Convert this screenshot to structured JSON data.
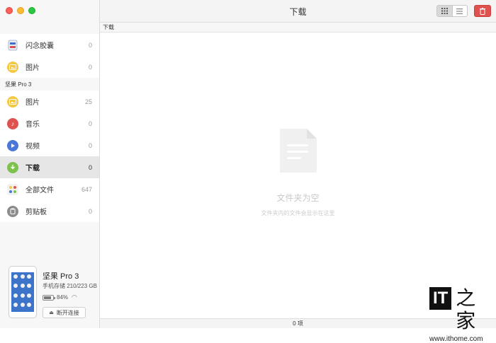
{
  "window": {
    "title": "下载"
  },
  "sidebar": {
    "top_items": [
      {
        "label": "闪念胶囊",
        "count": "0",
        "icon": "capsule-icon"
      },
      {
        "label": "图片",
        "count": "0",
        "icon": "image-icon"
      }
    ],
    "device_section_title": "坚果 Pro 3",
    "device_items": [
      {
        "label": "图片",
        "count": "25",
        "icon": "image-icon"
      },
      {
        "label": "音乐",
        "count": "0",
        "icon": "music-icon"
      },
      {
        "label": "视频",
        "count": "0",
        "icon": "video-icon"
      },
      {
        "label": "下载",
        "count": "0",
        "icon": "download-icon",
        "selected": true
      },
      {
        "label": "全部文件",
        "count": "647",
        "icon": "all-files-icon"
      },
      {
        "label": "剪贴板",
        "count": "0",
        "icon": "clipboard-icon"
      }
    ]
  },
  "device": {
    "name": "坚果 Pro 3",
    "storage": "手机存储 210/223 GB",
    "battery": "84%",
    "battery_level": 0.84,
    "disconnect_label": "断开连接"
  },
  "toolbar": {
    "grid_icon": "grid-view-icon",
    "list_icon": "list-view-icon",
    "delete_icon": "trash-icon",
    "delete_color": "#e0524f"
  },
  "pathbar": {
    "label": "下载"
  },
  "empty_state": {
    "title": "文件夹为空",
    "subtitle": "文件夹内的文件会显示在这里"
  },
  "status": {
    "count": "0 项"
  },
  "watermark": {
    "logo_text": "IT",
    "logo_han": "之家",
    "url": "www.ithome.com"
  }
}
